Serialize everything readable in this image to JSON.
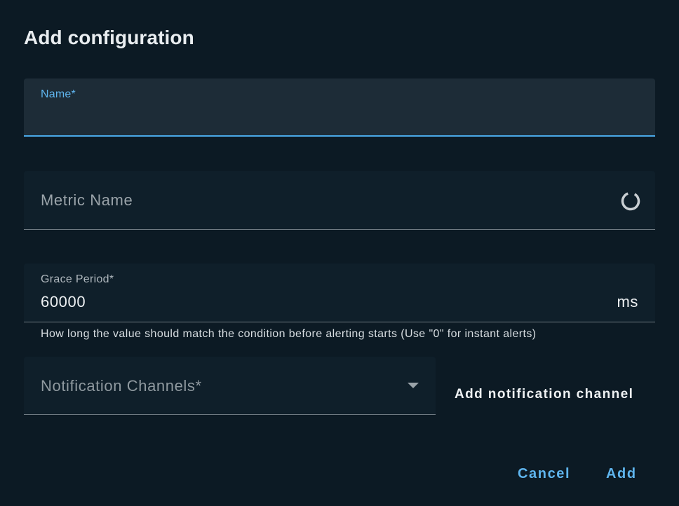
{
  "dialog": {
    "title": "Add configuration"
  },
  "fields": {
    "name": {
      "label": "Name*",
      "value": ""
    },
    "metric_name": {
      "placeholder": "Metric Name",
      "loading_icon": "loading-spinner-icon"
    },
    "grace_period": {
      "label": "Grace Period*",
      "value": "60000",
      "unit": "ms",
      "helper": "How long the value should match the condition before alerting starts (Use \"0\" for instant alerts)"
    },
    "notification_channels": {
      "placeholder": "Notification Channels*",
      "dropdown_icon": "caret-down-icon"
    }
  },
  "actions": {
    "add_notification_channel": "Add notification channel",
    "cancel": "Cancel",
    "add": "Add"
  },
  "colors": {
    "background": "#0c1a24",
    "accent": "#5fb5ee",
    "focused_underline": "#4aa9e8"
  }
}
